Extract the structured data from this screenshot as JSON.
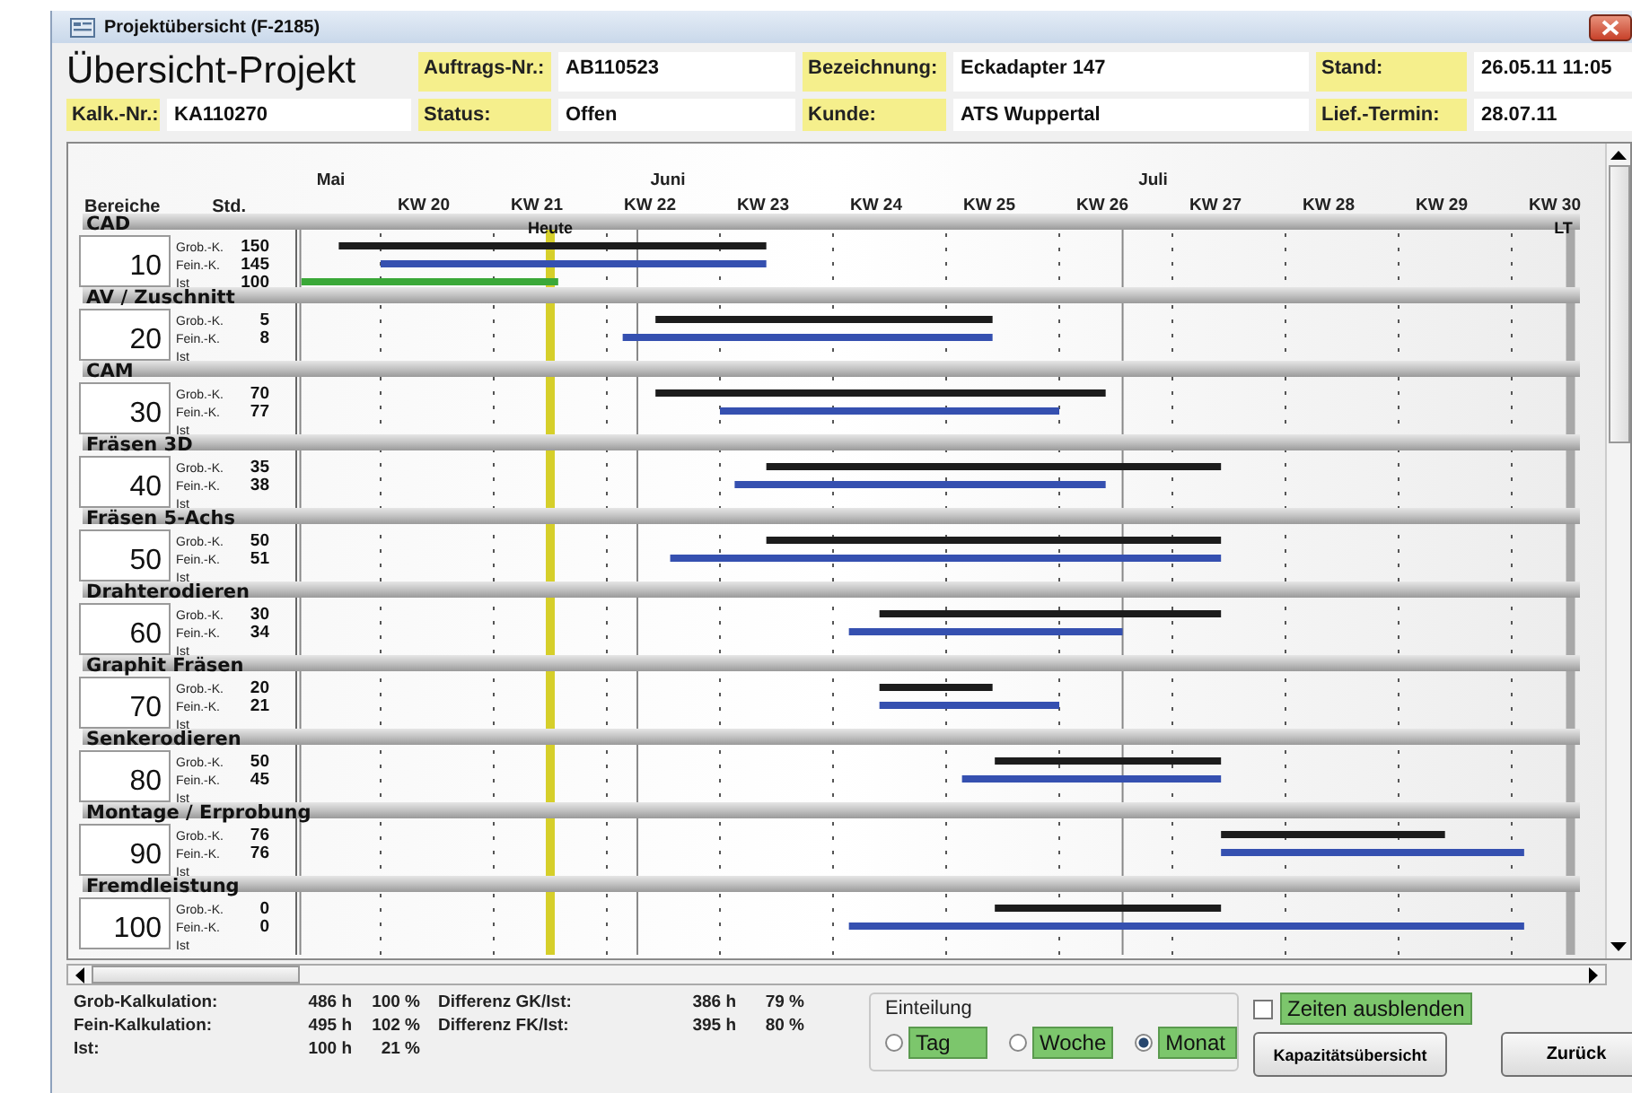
{
  "window": {
    "title": "Projektübersicht (F-2185)"
  },
  "header": {
    "title": "Übersicht-Projekt",
    "fields": [
      {
        "label": "Auftrags-Nr.:",
        "value": "AB110523"
      },
      {
        "label": "Bezeichnung:",
        "value": "Eckadapter 147"
      },
      {
        "label": "Stand:",
        "value": "26.05.11 11:05"
      },
      {
        "label": "Kalk.-Nr.:",
        "value": "KA110270"
      },
      {
        "label": "Status:",
        "value": "Offen"
      },
      {
        "label": "Kunde:",
        "value": "ATS Wuppertal"
      },
      {
        "label": "Lief.-Termin:",
        "value": "28.07.11"
      }
    ]
  },
  "gantt": {
    "columns": [
      "Bereiche",
      "Std."
    ],
    "months": [
      "Mai",
      "Juni",
      "Juli"
    ],
    "weeks": [
      "KW 20",
      "KW 21",
      "KW 22",
      "KW 23",
      "KW 24",
      "KW 25",
      "KW 26",
      "KW 27",
      "KW 28",
      "KW 29",
      "KW 30"
    ],
    "today_label": "Heute",
    "deadline_label": "LT",
    "sections": [
      {
        "name": "CAD",
        "code": "10",
        "lines": [
          {
            "label": "Grob.-K.",
            "value": "150"
          },
          {
            "label": "Fein.-K.",
            "value": "145"
          },
          {
            "label": "Ist",
            "value": "100"
          }
        ]
      },
      {
        "name": "AV / Zuschnitt",
        "code": "20",
        "lines": [
          {
            "label": "Grob.-K.",
            "value": "5"
          },
          {
            "label": "Fein.-K.",
            "value": "8"
          },
          {
            "label": "Ist"
          }
        ]
      },
      {
        "name": "CAM",
        "code": "30",
        "lines": [
          {
            "label": "Grob.-K.",
            "value": "70"
          },
          {
            "label": "Fein.-K.",
            "value": "77"
          },
          {
            "label": "Ist"
          }
        ]
      },
      {
        "name": "Fräsen 3D",
        "code": "40",
        "lines": [
          {
            "label": "Grob.-K.",
            "value": "35"
          },
          {
            "label": "Fein.-K.",
            "value": "38"
          },
          {
            "label": "Ist"
          }
        ]
      },
      {
        "name": "Fräsen 5-Achs",
        "code": "50",
        "lines": [
          {
            "label": "Grob.-K.",
            "value": "50"
          },
          {
            "label": "Fein.-K.",
            "value": "51"
          },
          {
            "label": "Ist"
          }
        ]
      },
      {
        "name": "Drahterodieren",
        "code": "60",
        "lines": [
          {
            "label": "Grob.-K.",
            "value": "30"
          },
          {
            "label": "Fein.-K.",
            "value": "34"
          },
          {
            "label": "Ist"
          }
        ]
      },
      {
        "name": "Graphit Fräsen",
        "code": "70",
        "lines": [
          {
            "label": "Grob.-K.",
            "value": "20"
          },
          {
            "label": "Fein.-K.",
            "value": "21"
          },
          {
            "label": "Ist"
          }
        ]
      },
      {
        "name": "Senkerodieren",
        "code": "80",
        "lines": [
          {
            "label": "Grob.-K.",
            "value": "50"
          },
          {
            "label": "Fein.-K.",
            "value": "45"
          },
          {
            "label": "Ist"
          }
        ]
      },
      {
        "name": "Montage / Erprobung",
        "code": "90",
        "lines": [
          {
            "label": "Grob.-K.",
            "value": "76"
          },
          {
            "label": "Fein.-K.",
            "value": "76"
          },
          {
            "label": "Ist"
          }
        ]
      },
      {
        "name": "Fremdleistung",
        "code": "100",
        "lines": [
          {
            "label": "Grob.-K.",
            "value": "0"
          },
          {
            "label": "Fein.-K.",
            "value": "0"
          },
          {
            "label": "Ist"
          }
        ]
      }
    ]
  },
  "stats": [
    {
      "label": "Grob-Kalkulation:",
      "hours": "486 h",
      "percent": "100 %",
      "diff_label": "Differenz GK/Ist:",
      "diff_hours": "386 h",
      "diff_percent": "79 %"
    },
    {
      "label": "Fein-Kalkulation:",
      "hours": "495 h",
      "percent": "102 %",
      "diff_label": "Differenz FK/Ist:",
      "diff_hours": "395 h",
      "diff_percent": "80 %"
    },
    {
      "label": "Ist:",
      "hours": "100 h",
      "percent": "21 %"
    }
  ],
  "division": {
    "title": "Einteilung",
    "options": [
      {
        "label": "Tag",
        "selected": false
      },
      {
        "label": "Woche",
        "selected": false
      },
      {
        "label": "Monat",
        "selected": true
      }
    ]
  },
  "hide_times": {
    "label": "Zeiten ausblenden",
    "checked": false
  },
  "buttons": [
    "Kapazitätsübersicht",
    "Zurück"
  ]
}
